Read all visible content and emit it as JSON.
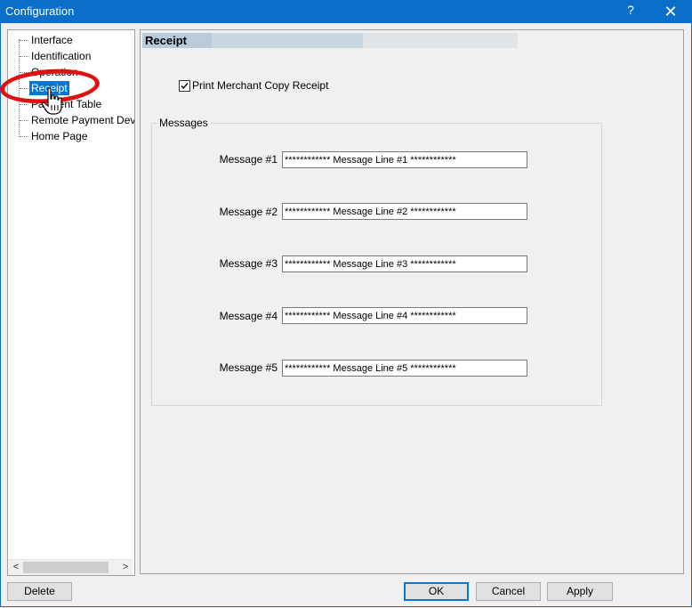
{
  "window": {
    "title": "Configuration",
    "help_glyph": "?",
    "close_glyph": "✕"
  },
  "tree": {
    "items": [
      {
        "label": "Interface"
      },
      {
        "label": "Identification"
      },
      {
        "label": "Operation"
      },
      {
        "label": "Receipt",
        "selected": true
      },
      {
        "label": "Payment Table"
      },
      {
        "label": "Remote Payment Devi"
      },
      {
        "label": "Home Page"
      }
    ],
    "scroll_left": "<",
    "scroll_right": ">"
  },
  "panel": {
    "header": "Receipt",
    "print_merchant_copy": {
      "label": "Print Merchant Copy Receipt",
      "checked": true
    },
    "messages_group": {
      "title": "Messages",
      "rows": [
        {
          "label": "Message #1",
          "value": "************ Message Line #1 ************"
        },
        {
          "label": "Message #2",
          "value": "************ Message Line #2 ************"
        },
        {
          "label": "Message #3",
          "value": "************ Message Line #3 ************"
        },
        {
          "label": "Message #4",
          "value": "************ Message Line #4 ************"
        },
        {
          "label": "Message #5",
          "value": "************ Message Line #5 ************"
        }
      ]
    }
  },
  "buttons": {
    "delete": "Delete",
    "ok": "OK",
    "cancel": "Cancel",
    "apply": "Apply"
  },
  "colors": {
    "titlebar": "#0b6fc9",
    "selection": "#0078d7",
    "annotation": "#e01010"
  }
}
